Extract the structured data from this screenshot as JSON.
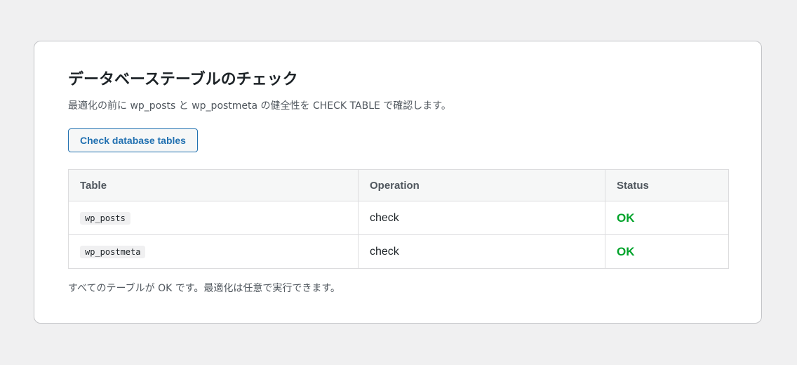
{
  "panel": {
    "title": "データベーステーブルのチェック",
    "description": "最適化の前に wp_posts と wp_postmeta の健全性を CHECK TABLE で確認します。",
    "check_button_label": "Check database tables",
    "table": {
      "headers": [
        "Table",
        "Operation",
        "Status"
      ],
      "rows": [
        {
          "table": "wp_posts",
          "operation": "check",
          "status": "OK"
        },
        {
          "table": "wp_postmeta",
          "operation": "check",
          "status": "OK"
        }
      ]
    },
    "footer_note": "すべてのテーブルが OK です。最適化は任意で実行できます。"
  },
  "colors": {
    "status_ok": "#00a32a",
    "accent": "#2271b1"
  }
}
